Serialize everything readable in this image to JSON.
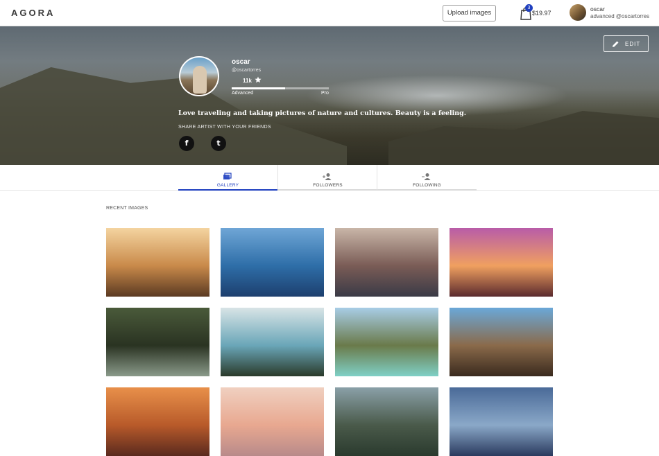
{
  "app": {
    "logo": "AGORA"
  },
  "topnav": {
    "upload_label": "Upload images",
    "cart_count": "3",
    "cart_total": "$19.97",
    "user_name": "oscar",
    "user_sub": "advanced @oscartorres",
    "icons": {
      "cart": "shopping-bag-icon",
      "avatar": "avatar"
    }
  },
  "hero": {
    "edit_label": "EDIT",
    "name": "oscar",
    "handle": "@oscartorres",
    "rating": "11k",
    "level_progress": 0.55,
    "level_from": "Advanced",
    "level_to": "Pro",
    "bio": "Love traveling and taking pictures of nature and cultures. Beauty is a feeling.",
    "share_label": "SHARE ARTIST WITH YOUR FRIENDS",
    "social": [
      {
        "label": "f",
        "icon": "facebook-icon"
      },
      {
        "label": "t",
        "icon": "twitter-icon"
      }
    ]
  },
  "tabs": [
    {
      "label": "GALLERY",
      "icon": "gallery-icon",
      "active": true
    },
    {
      "label": "FOLLOWERS",
      "icon": "followers-icon",
      "active": false
    },
    {
      "label": "FOLLOWING",
      "icon": "following-icon",
      "active": false
    }
  ],
  "gallery": {
    "title": "RECENT IMAGES",
    "images": [
      {
        "name": "buffalo-sunset",
        "colors": [
          "#f4d4a0",
          "#c98a4a",
          "#5b3a22"
        ]
      },
      {
        "name": "ocean-water",
        "colors": [
          "#6fa6d6",
          "#2e6ea8",
          "#1d3f6e"
        ]
      },
      {
        "name": "graffiti-street",
        "colors": [
          "#c9b6a8",
          "#7a5c56",
          "#3a3a46"
        ]
      },
      {
        "name": "beach-sunset",
        "colors": [
          "#b85ca8",
          "#f0a060",
          "#5a2a2e"
        ]
      },
      {
        "name": "forest-waterfall",
        "colors": [
          "#4a5a3a",
          "#2a3322",
          "#8a9a8a"
        ]
      },
      {
        "name": "tree-over-sea",
        "colors": [
          "#d8e4e6",
          "#6aa6b8",
          "#2a3a2a"
        ]
      },
      {
        "name": "turquoise-lagoon",
        "colors": [
          "#a8cde6",
          "#6a7a4a",
          "#7fd0c6"
        ]
      },
      {
        "name": "cliff-waterfall",
        "colors": [
          "#6aa8d8",
          "#8a6a4a",
          "#3a2a1e"
        ]
      },
      {
        "name": "orange-sky",
        "colors": [
          "#e8904a",
          "#b85a2a",
          "#5a2a1e"
        ]
      },
      {
        "name": "pastel-sky",
        "colors": [
          "#f0d0c0",
          "#e8a890",
          "#b88a8a"
        ]
      },
      {
        "name": "river-forest",
        "colors": [
          "#8aa0a8",
          "#4a5a4a",
          "#2a3a2e"
        ]
      },
      {
        "name": "cloudy-sky",
        "colors": [
          "#4a6a98",
          "#8aa8c8",
          "#2a3a5e"
        ]
      }
    ]
  }
}
